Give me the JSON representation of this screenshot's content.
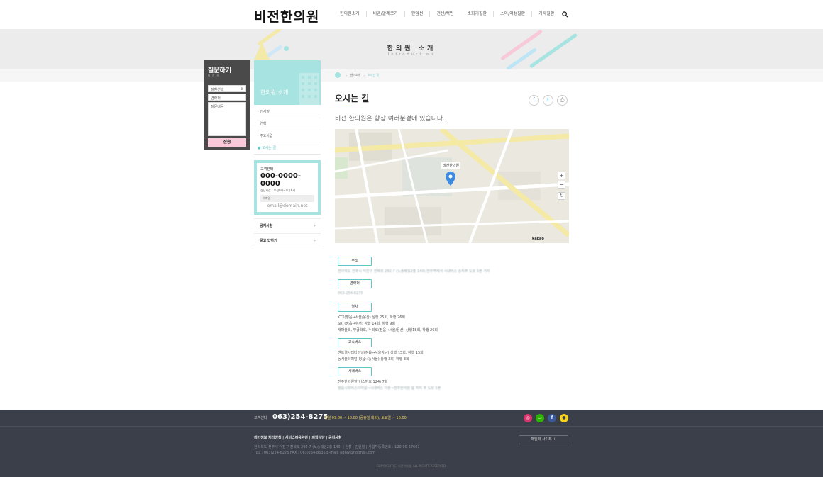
{
  "header": {
    "logo": "비전한의원",
    "nav": [
      "한의원소개",
      "비염/알레르기",
      "한입선",
      "건선/백반",
      "소화기질환",
      "소아/여성질환",
      "기타질환"
    ]
  },
  "visual": {
    "title": "한의원 소개",
    "subtitle": "Introduction"
  },
  "qna": {
    "title": "질문하기",
    "subtitle": "Q N A",
    "select": "질환선택",
    "contact_placeholder": "연락처",
    "question_placeholder": "질문내용",
    "submit": "전송"
  },
  "lnb": {
    "title": "한의원 소개",
    "items": [
      "인사말",
      "연혁",
      "주요사업",
      "오시는 길"
    ]
  },
  "cs": {
    "label": "고객센터",
    "phone": "000-0000-0000",
    "hours": "상담시간 : 오전9시~오후6시",
    "mail_label": "이메일",
    "mail": "email@domain.net"
  },
  "side_links": [
    "공지사항",
    "묻고 답하기"
  ],
  "breadcrumb": {
    "parent": "센터소개",
    "current": "오시는 길"
  },
  "page": {
    "title": "오시는 길",
    "lead": "비전 한의원은 항상 여러분곁에 있습니다."
  },
  "map": {
    "marker_label": "비전한의원",
    "logo": "kakao"
  },
  "info": {
    "address_label": "주소",
    "address": "전라북도 전주시 덕진구 전북로 292-7 (노송웨딩2층 140) 전주역에서 시내버스 승차후 도보 5분 거리",
    "phone_label": "연락처",
    "phone": "063-254-8275",
    "train_label": "열차",
    "train": [
      "KTX(정읍↔서울/용산) 상행 25회, 하행 26회",
      "SRT(정읍↔수서) 상행 14회, 하행 9회",
      "새마을호, 무궁화호, 누리로(정읍↔서울/용산) 상행18회, 하행 26회"
    ],
    "express_label": "고속버스",
    "express": [
      "센트럴시티터미널(정읍↔서울강남) 상행 15회, 하행 15회",
      "동서울터미널(정읍↔동서울) 상행 3회, 하행 3회"
    ],
    "city_label": "시내버스",
    "city": [
      "전주한의원앞(버스번호 124) 7회",
      "정읍시외버스터미널→시내버스 이용→전주한의원 앞 하차 후 도보 5분"
    ]
  },
  "footer": {
    "cs_label": "고객센터",
    "phone": "063)254-8275",
    "hours": "평일 09:00 ~ 18:00 (공휴일 제외), 토요일 ~ 16:00",
    "links": "개인정보 처리방침 | 서비스이용약관 | 의학상담 | 공지사항",
    "addr1": "전라북도 전주시 덕진구 전북로 292-7 (노송웨딩2층 140)  |  원장 : 김원철  |  사업자등록번호 : 120-90-67607",
    "addr2": "TEL : 063)254-8275   FAX : 063)254-8535   E-mail: pghw@hotmail.com",
    "family_site": "패밀리 사이트 +",
    "copyright": "COPYRIGHT(C) 비전한의원. ALL RIGHTS RESERVED."
  },
  "colors": {
    "accent": "#a7e3e0",
    "accent_text": "#5ec9c3",
    "footer_bg": "#3a3f49",
    "pink": "#f7c9d9"
  }
}
